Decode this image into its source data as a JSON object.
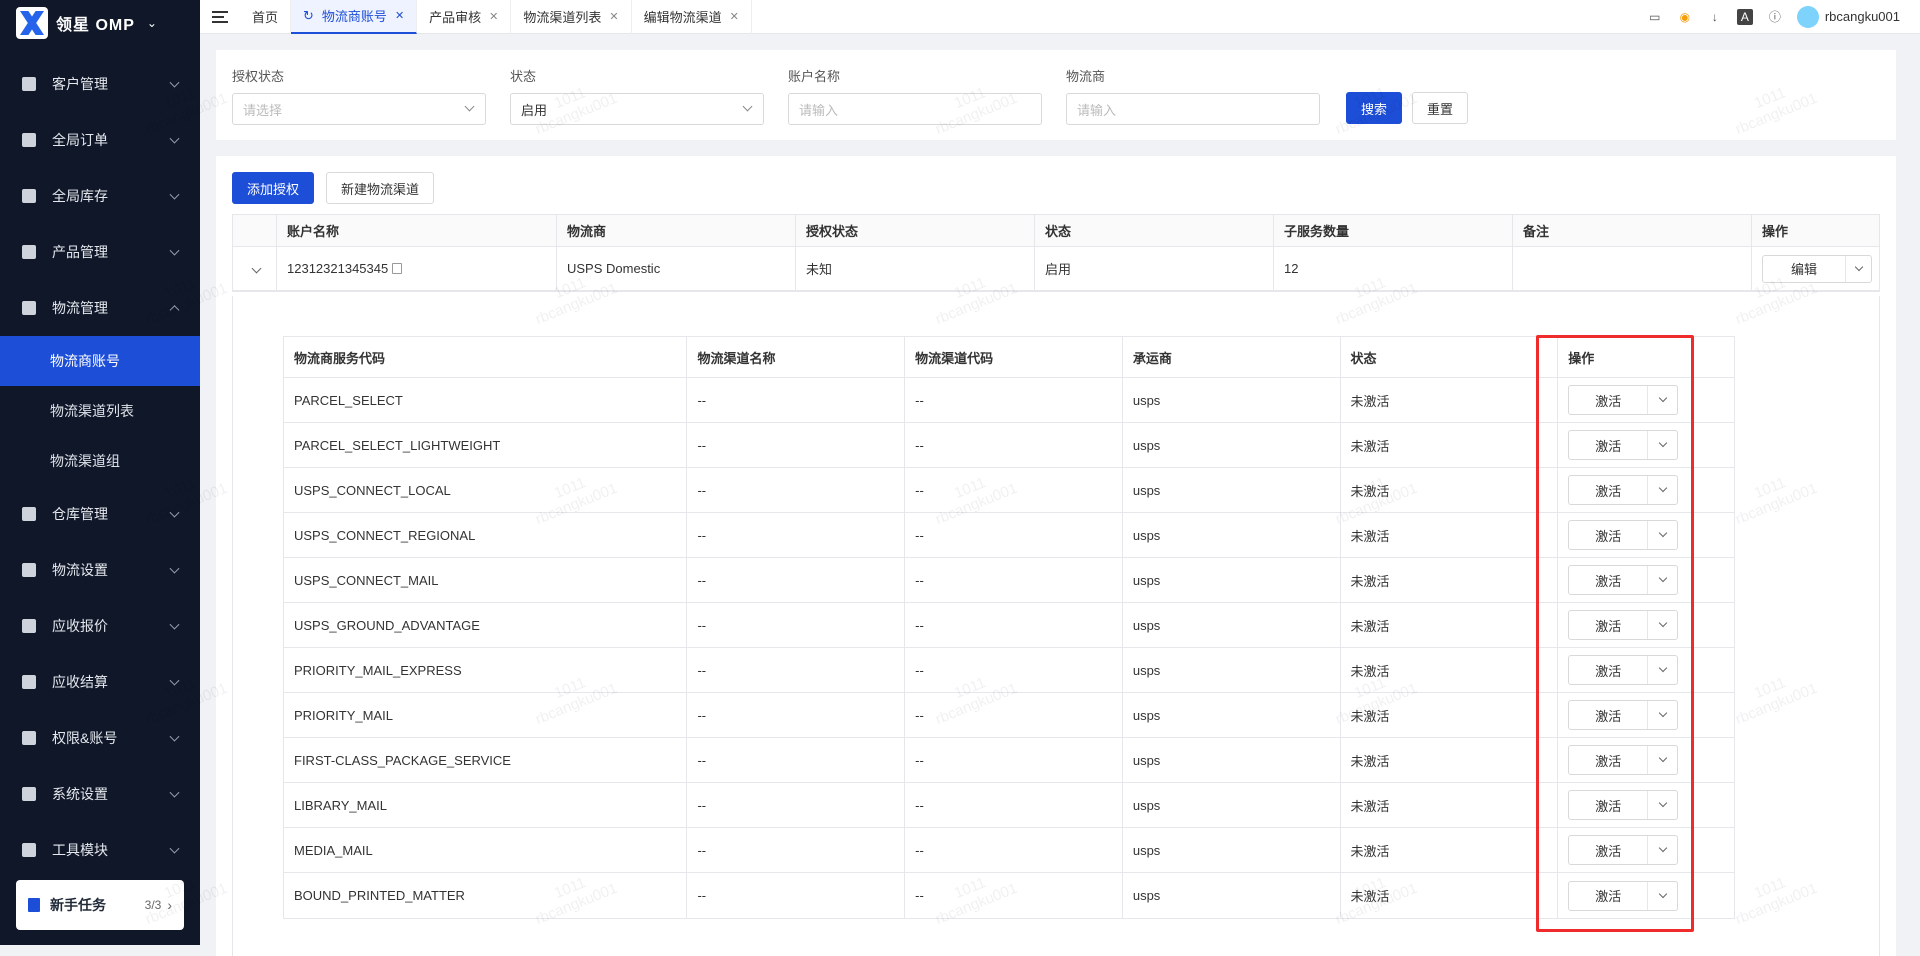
{
  "app": {
    "name": "领星 OMP"
  },
  "sidebar": {
    "items": [
      {
        "label": "客户管理",
        "icon": "users-icon"
      },
      {
        "label": "全局订单",
        "icon": "order-icon"
      },
      {
        "label": "全局库存",
        "icon": "warehouse-icon"
      },
      {
        "label": "产品管理",
        "icon": "box-icon"
      },
      {
        "label": "物流管理",
        "icon": "truck-icon",
        "expanded": true
      }
    ],
    "sub_items": [
      {
        "label": "物流商账号",
        "active": true
      },
      {
        "label": "物流渠道列表"
      },
      {
        "label": "物流渠道组"
      }
    ],
    "items_after": [
      {
        "label": "仓库管理",
        "icon": "storage-icon"
      },
      {
        "label": "物流设置",
        "icon": "cube-icon"
      },
      {
        "label": "应收报价",
        "icon": "quote-icon"
      },
      {
        "label": "应收结算",
        "icon": "coin-icon"
      },
      {
        "label": "权限&账号",
        "icon": "org-icon"
      },
      {
        "label": "系统设置",
        "icon": "settings-icon"
      },
      {
        "label": "工具模块",
        "icon": "tool-icon"
      }
    ],
    "newbie": {
      "label": "新手任务",
      "count": "3/3"
    }
  },
  "tabs": [
    {
      "label": "首页",
      "closable": false
    },
    {
      "label": "物流商账号",
      "active": true,
      "closable": true
    },
    {
      "label": "产品审核",
      "closable": true
    },
    {
      "label": "物流渠道列表",
      "closable": true
    },
    {
      "label": "编辑物流渠道",
      "closable": true
    }
  ],
  "user": {
    "name": "rbcangku001"
  },
  "filters": {
    "auth_status": {
      "label": "授权状态",
      "placeholder": "请选择"
    },
    "status": {
      "label": "状态",
      "value": "启用"
    },
    "account_name": {
      "label": "账户名称",
      "placeholder": "请输入"
    },
    "carrier": {
      "label": "物流商",
      "placeholder": "请输入"
    },
    "search_label": "搜索",
    "reset_label": "重置"
  },
  "actions": {
    "add_auth": "添加授权",
    "new_channel": "新建物流渠道"
  },
  "main_table": {
    "headers": [
      "账户名称",
      "物流商",
      "授权状态",
      "状态",
      "子服务数量",
      "备注",
      "操作"
    ],
    "row": {
      "account": "12312321345345",
      "carrier": "USPS Domestic",
      "auth_status": "未知",
      "status": "启用",
      "sub_count": "12",
      "remark": "",
      "action": "编辑"
    }
  },
  "sub_table": {
    "headers": [
      "物流商服务代码",
      "物流渠道名称",
      "物流渠道代码",
      "承运商",
      "状态",
      "操作"
    ],
    "rows": [
      {
        "code": "PARCEL_SELECT",
        "name": "--",
        "channel_code": "--",
        "carrier": "usps",
        "status": "未激活",
        "action": "激活"
      },
      {
        "code": "PARCEL_SELECT_LIGHTWEIGHT",
        "name": "--",
        "channel_code": "--",
        "carrier": "usps",
        "status": "未激活",
        "action": "激活"
      },
      {
        "code": "USPS_CONNECT_LOCAL",
        "name": "--",
        "channel_code": "--",
        "carrier": "usps",
        "status": "未激活",
        "action": "激活"
      },
      {
        "code": "USPS_CONNECT_REGIONAL",
        "name": "--",
        "channel_code": "--",
        "carrier": "usps",
        "status": "未激活",
        "action": "激活"
      },
      {
        "code": "USPS_CONNECT_MAIL",
        "name": "--",
        "channel_code": "--",
        "carrier": "usps",
        "status": "未激活",
        "action": "激活"
      },
      {
        "code": "USPS_GROUND_ADVANTAGE",
        "name": "--",
        "channel_code": "--",
        "carrier": "usps",
        "status": "未激活",
        "action": "激活"
      },
      {
        "code": "PRIORITY_MAIL_EXPRESS",
        "name": "--",
        "channel_code": "--",
        "carrier": "usps",
        "status": "未激活",
        "action": "激活"
      },
      {
        "code": "PRIORITY_MAIL",
        "name": "--",
        "channel_code": "--",
        "carrier": "usps",
        "status": "未激活",
        "action": "激活"
      },
      {
        "code": "FIRST-CLASS_PACKAGE_SERVICE",
        "name": "--",
        "channel_code": "--",
        "carrier": "usps",
        "status": "未激活",
        "action": "激活"
      },
      {
        "code": "LIBRARY_MAIL",
        "name": "--",
        "channel_code": "--",
        "carrier": "usps",
        "status": "未激活",
        "action": "激活"
      },
      {
        "code": "MEDIA_MAIL",
        "name": "--",
        "channel_code": "--",
        "carrier": "usps",
        "status": "未激活",
        "action": "激活"
      },
      {
        "code": "BOUND_PRINTED_MATTER",
        "name": "--",
        "channel_code": "--",
        "carrier": "usps",
        "status": "未激活",
        "action": "激活"
      }
    ]
  },
  "watermark": {
    "line1": "1011",
    "line2": "rbcangku001"
  },
  "colors": {
    "primary": "#1d4ed8",
    "sidebar_bg": "#0f1729",
    "highlight": "#ef2b2b"
  }
}
